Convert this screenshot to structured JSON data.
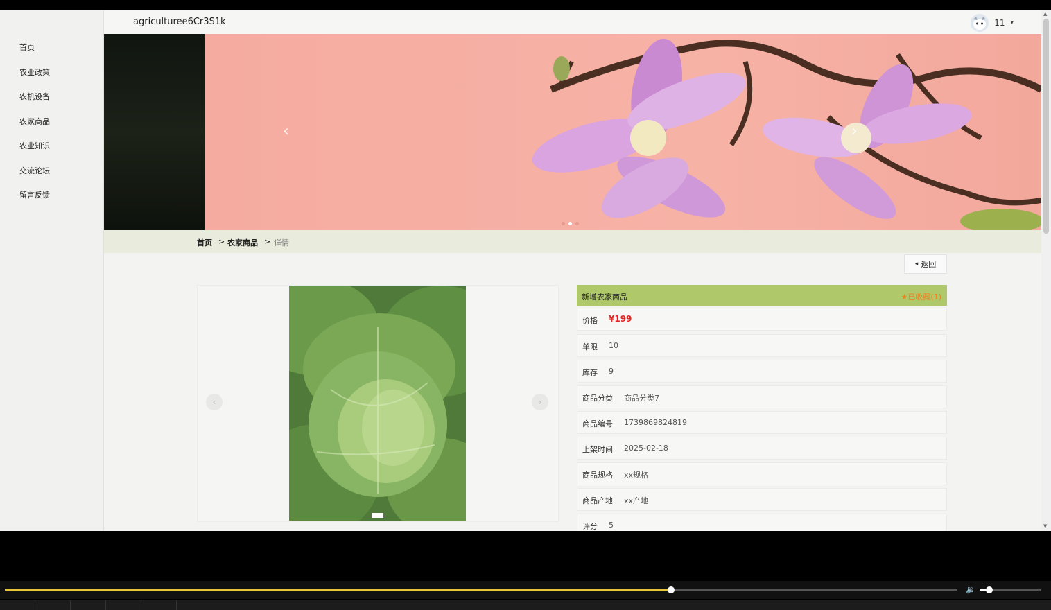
{
  "site": {
    "title": "agricultureе6Cr3S1k"
  },
  "sidebar": {
    "items": [
      {
        "label": "首页"
      },
      {
        "label": "农业政策"
      },
      {
        "label": "农机设备"
      },
      {
        "label": "农家商品"
      },
      {
        "label": "农业知识"
      },
      {
        "label": "交流论坛"
      },
      {
        "label": "留言反馈"
      }
    ]
  },
  "user": {
    "name": "11",
    "caret": "▾"
  },
  "banner": {
    "prev": "‹",
    "next": "›",
    "slide_count": 3,
    "active_slide": 2
  },
  "breadcrumb": {
    "home": "首页",
    "sep": ">",
    "category": "农家商品",
    "current": "详情"
  },
  "back_button": {
    "label": "返回",
    "icon": "◂"
  },
  "gallery": {
    "prev": "‹",
    "next": "›"
  },
  "product": {
    "header_title": "新增农家商品",
    "favorite": "★已收藏(1)",
    "fields": [
      {
        "key": "价格",
        "value": "¥199"
      },
      {
        "key": "单限",
        "value": "10"
      },
      {
        "key": "库存",
        "value": "9"
      },
      {
        "key": "商品分类",
        "value": "商品分类7"
      },
      {
        "key": "商品编号",
        "value": "1739869824819"
      },
      {
        "key": "上架时间",
        "value": "2025-02-18"
      },
      {
        "key": "商品规格",
        "value": "xx规格"
      },
      {
        "key": "商品产地",
        "value": "xx产地"
      },
      {
        "key": "评分",
        "value": "5"
      }
    ]
  },
  "player": {
    "progress": 0.7,
    "volume": 0.1
  },
  "colors": {
    "accent_green": "#afc86a",
    "price_red": "#e12424",
    "favorite_orange": "#f08020",
    "seek_yellow": "#e8c23a"
  }
}
